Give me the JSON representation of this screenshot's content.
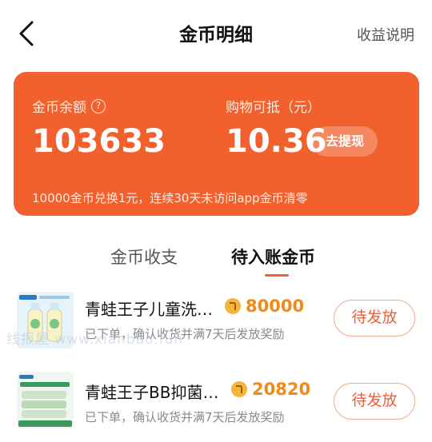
{
  "header": {
    "title": "金币明细",
    "help_link": "收益说明"
  },
  "balance_card": {
    "coin_label": "金币余额",
    "coin_value": "103633",
    "cash_label": "购物可抵（元）",
    "cash_value": "10.36",
    "withdraw_button": "去提现",
    "note": "10000金币兑换1元，连续30天未访问app金币清零",
    "background_color": "#f2612d"
  },
  "tabs": [
    {
      "label": "金币收支",
      "active": false
    },
    {
      "label": "待入账金币",
      "active": true
    }
  ],
  "items": [
    {
      "title": "青蛙王子儿童洗…",
      "coins": "80000",
      "desc": "已下单，确认收货并满7天后发放奖励",
      "status": "待发放",
      "thumb_icon": "kids-wash-product-icon"
    },
    {
      "title": "青蛙王子BB抑菌…",
      "coins": "20820",
      "desc": "已下单，确认收货并满7天后发放奖励",
      "status": "待发放",
      "thumb_icon": "bb-soap-product-icon"
    }
  ],
  "watermark": "线报屋 www.xianbao.fun",
  "colors": {
    "accent": "#f2612d",
    "coin": "#f08a18",
    "status_text": "#f05d3a"
  }
}
